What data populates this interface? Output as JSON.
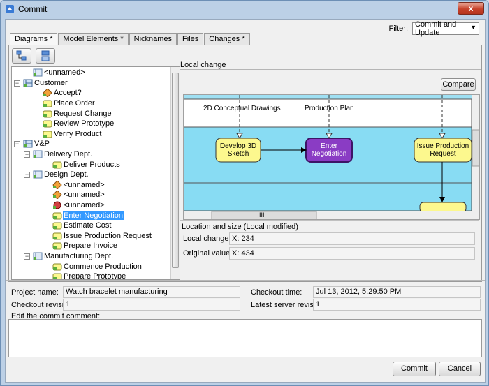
{
  "window": {
    "title": "Commit",
    "close_glyph": "x"
  },
  "filter": {
    "label": "Filter:",
    "value": "Commit and Update"
  },
  "tabs": [
    {
      "label": "Diagrams *"
    },
    {
      "label": "Model Elements *"
    },
    {
      "label": "Nicknames"
    },
    {
      "label": "Files"
    },
    {
      "label": "Changes *"
    }
  ],
  "tree": {
    "items": [
      {
        "label": "<unnamed>",
        "icon": "lane-icon"
      },
      {
        "label": "Customer",
        "icon": "pool-icon"
      },
      {
        "label": "Accept?",
        "icon": "gateway-icon"
      },
      {
        "label": "Place Order",
        "icon": "task-icon"
      },
      {
        "label": "Request Change",
        "icon": "task-icon"
      },
      {
        "label": "Review Prototype",
        "icon": "task-icon"
      },
      {
        "label": "Verify Product",
        "icon": "task-icon"
      },
      {
        "label": "V&P",
        "icon": "pool-icon"
      },
      {
        "label": "Delivery Dept.",
        "icon": "lane-icon"
      },
      {
        "label": "Deliver Products",
        "icon": "task-icon"
      },
      {
        "label": "Design Dept.",
        "icon": "lane-icon"
      },
      {
        "label": "<unnamed>",
        "icon": "gateway-icon"
      },
      {
        "label": "<unnamed>",
        "icon": "gateway-icon"
      },
      {
        "label": "<unnamed>",
        "icon": "end-event-icon"
      },
      {
        "label": "Enter Negotiation",
        "icon": "task-icon"
      },
      {
        "label": "Estimate Cost",
        "icon": "task-icon"
      },
      {
        "label": "Issue Production Request",
        "icon": "task-icon"
      },
      {
        "label": "Prepare Invoice",
        "icon": "task-icon"
      },
      {
        "label": "Manufacturing Dept.",
        "icon": "lane-icon"
      },
      {
        "label": "Commence Production",
        "icon": "task-icon"
      },
      {
        "label": "Prepare Prototype",
        "icon": "task-icon"
      }
    ]
  },
  "right_pane": {
    "title": "Local change",
    "compare_label": "Compare",
    "diagram": {
      "labels": [
        "2D Conceptual Drawings",
        "Production Plan"
      ],
      "tasks": [
        "Develop 3D Sketch",
        "Enter Negotiation",
        "Issue Production Request"
      ],
      "scrollbar_grip": "III"
    },
    "location": {
      "title": "Location and size (Local modified)",
      "local_label": "Local change:",
      "local_value": "X: 234",
      "original_label": "Original value:",
      "original_value": "X: 434"
    }
  },
  "info": {
    "project_name_label": "Project name:",
    "project_name_value": "Watch bracelet manufacturing",
    "checkout_revision_label": "Checkout revision:",
    "checkout_revision_value": "1",
    "checkout_time_label": "Checkout time:",
    "checkout_time_value": "Jul 13, 2012, 5:29:50 PM",
    "latest_revision_label": "Latest server revision:",
    "latest_revision_value": "1"
  },
  "comment": {
    "label": "Edit the commit comment:",
    "value": ""
  },
  "buttons": {
    "commit": "Commit",
    "cancel": "Cancel"
  },
  "colors": {
    "lane_bg": "#88dcf3",
    "task_fill": "#fcf88e",
    "selected_task_fill": "#8a3cc4",
    "selection": "#3399ff"
  }
}
